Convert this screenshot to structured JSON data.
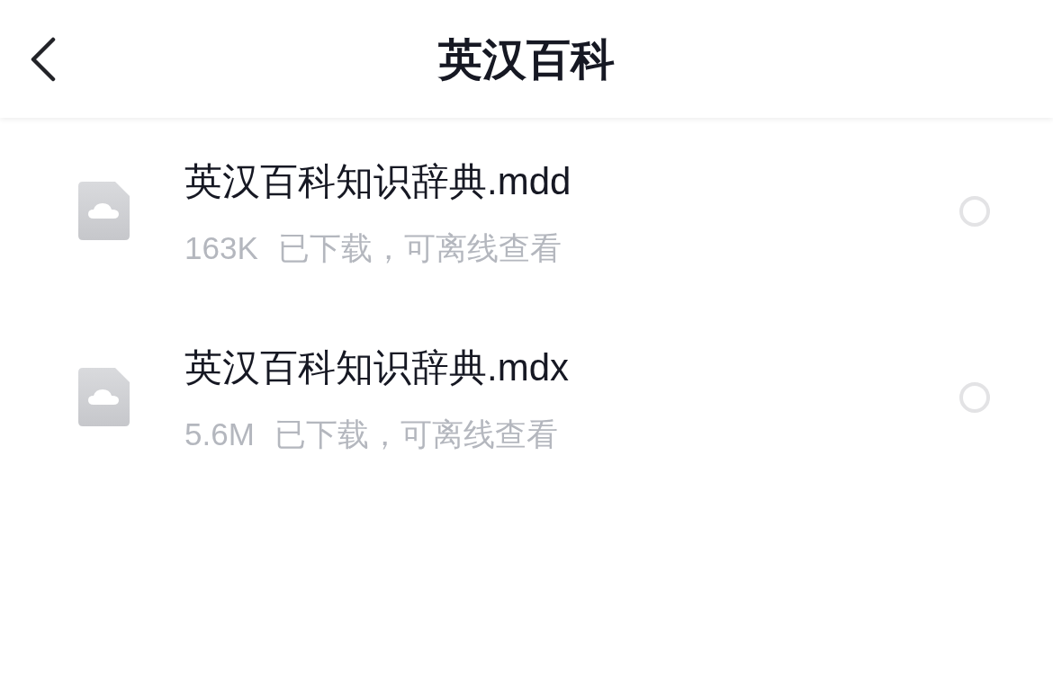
{
  "header": {
    "title": "英汉百科"
  },
  "files": [
    {
      "name": "英汉百科知识辞典.mdd",
      "size": "163K",
      "status": "已下载，可离线查看",
      "selected": false
    },
    {
      "name": "英汉百科知识辞典.mdx",
      "size": "5.6M",
      "status": "已下载，可离线查看",
      "selected": false
    }
  ]
}
